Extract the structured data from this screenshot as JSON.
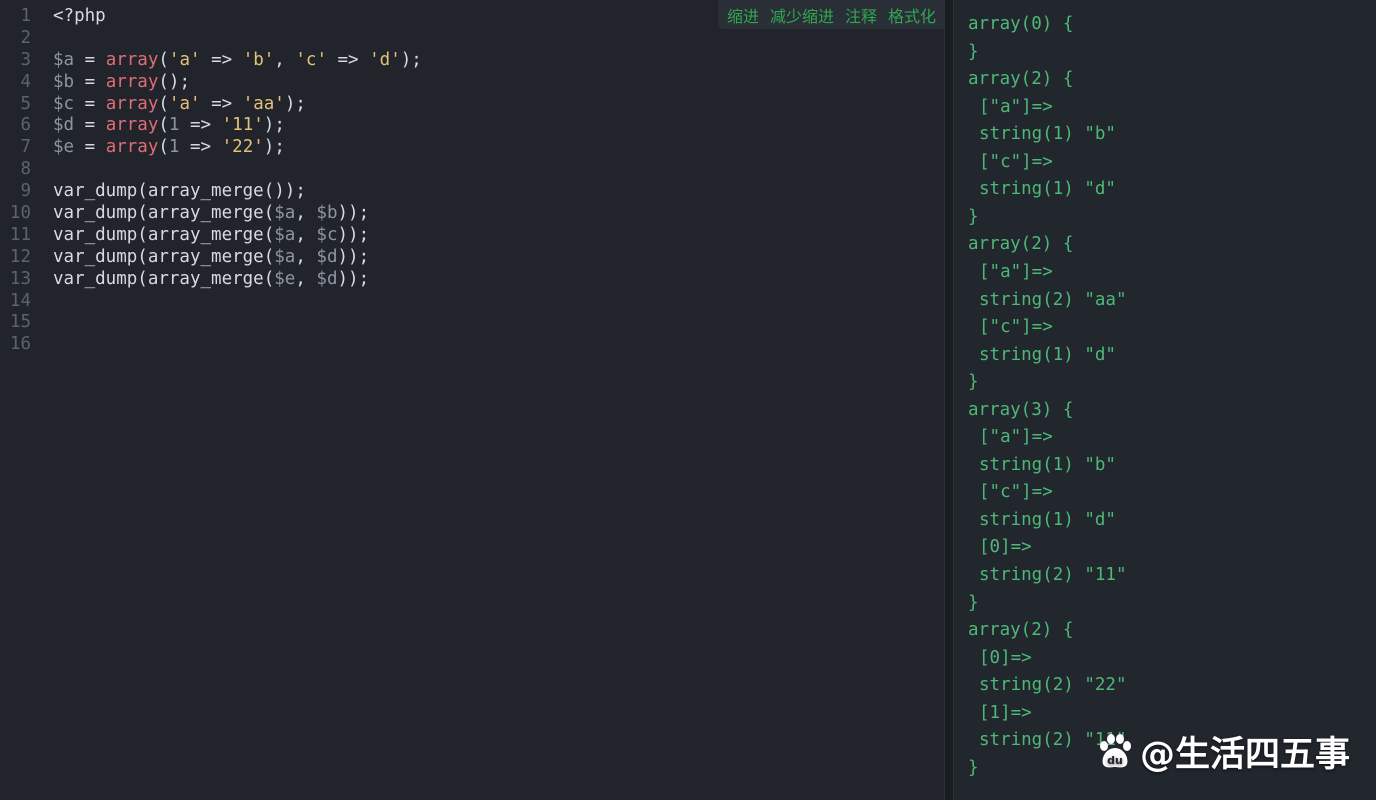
{
  "toolbar": {
    "indent_label": "缩进",
    "outdent_label": "减少缩进",
    "comment_label": "注释",
    "format_label": "格式化"
  },
  "editor": {
    "lines": [
      {
        "n": "1",
        "tokens": [
          {
            "t": "<?php",
            "c": "plain"
          }
        ]
      },
      {
        "n": "2",
        "tokens": []
      },
      {
        "n": "3",
        "tokens": [
          {
            "t": "$a",
            "c": "var"
          },
          {
            "t": " = ",
            "c": "plain"
          },
          {
            "t": "array",
            "c": "fn"
          },
          {
            "t": "(",
            "c": "plain"
          },
          {
            "t": "'a'",
            "c": "str"
          },
          {
            "t": " => ",
            "c": "plain"
          },
          {
            "t": "'b'",
            "c": "str"
          },
          {
            "t": ", ",
            "c": "plain"
          },
          {
            "t": "'c'",
            "c": "str"
          },
          {
            "t": " => ",
            "c": "plain"
          },
          {
            "t": "'d'",
            "c": "str"
          },
          {
            "t": ");",
            "c": "plain"
          }
        ]
      },
      {
        "n": "4",
        "tokens": [
          {
            "t": "$b",
            "c": "var"
          },
          {
            "t": " = ",
            "c": "plain"
          },
          {
            "t": "array",
            "c": "fn"
          },
          {
            "t": "();",
            "c": "plain"
          }
        ]
      },
      {
        "n": "5",
        "tokens": [
          {
            "t": "$c",
            "c": "var"
          },
          {
            "t": " = ",
            "c": "plain"
          },
          {
            "t": "array",
            "c": "fn"
          },
          {
            "t": "(",
            "c": "plain"
          },
          {
            "t": "'a'",
            "c": "str"
          },
          {
            "t": " => ",
            "c": "plain"
          },
          {
            "t": "'aa'",
            "c": "str"
          },
          {
            "t": ");",
            "c": "plain"
          }
        ]
      },
      {
        "n": "6",
        "tokens": [
          {
            "t": "$d",
            "c": "var"
          },
          {
            "t": " = ",
            "c": "plain"
          },
          {
            "t": "array",
            "c": "fn"
          },
          {
            "t": "(",
            "c": "plain"
          },
          {
            "t": "1",
            "c": "num"
          },
          {
            "t": " => ",
            "c": "plain"
          },
          {
            "t": "'11'",
            "c": "str"
          },
          {
            "t": ");",
            "c": "plain"
          }
        ]
      },
      {
        "n": "7",
        "tokens": [
          {
            "t": "$e",
            "c": "var"
          },
          {
            "t": " = ",
            "c": "plain"
          },
          {
            "t": "array",
            "c": "fn"
          },
          {
            "t": "(",
            "c": "plain"
          },
          {
            "t": "1",
            "c": "num"
          },
          {
            "t": " => ",
            "c": "plain"
          },
          {
            "t": "'22'",
            "c": "str"
          },
          {
            "t": ");",
            "c": "plain"
          }
        ]
      },
      {
        "n": "8",
        "tokens": []
      },
      {
        "n": "9",
        "tokens": [
          {
            "t": "var_dump(array_merge());",
            "c": "plain"
          }
        ]
      },
      {
        "n": "10",
        "tokens": [
          {
            "t": "var_dump(array_merge(",
            "c": "plain"
          },
          {
            "t": "$a",
            "c": "var"
          },
          {
            "t": ", ",
            "c": "plain"
          },
          {
            "t": "$b",
            "c": "var"
          },
          {
            "t": "));",
            "c": "plain"
          }
        ]
      },
      {
        "n": "11",
        "tokens": [
          {
            "t": "var_dump(array_merge(",
            "c": "plain"
          },
          {
            "t": "$a",
            "c": "var"
          },
          {
            "t": ", ",
            "c": "plain"
          },
          {
            "t": "$c",
            "c": "var"
          },
          {
            "t": "));",
            "c": "plain"
          }
        ]
      },
      {
        "n": "12",
        "tokens": [
          {
            "t": "var_dump(array_merge(",
            "c": "plain"
          },
          {
            "t": "$a",
            "c": "var"
          },
          {
            "t": ", ",
            "c": "plain"
          },
          {
            "t": "$d",
            "c": "var"
          },
          {
            "t": "));",
            "c": "plain"
          }
        ]
      },
      {
        "n": "13",
        "tokens": [
          {
            "t": "var_dump(array_merge(",
            "c": "plain"
          },
          {
            "t": "$e",
            "c": "var"
          },
          {
            "t": ", ",
            "c": "plain"
          },
          {
            "t": "$d",
            "c": "var"
          },
          {
            "t": "));",
            "c": "plain"
          }
        ]
      },
      {
        "n": "14",
        "tokens": []
      },
      {
        "n": "15",
        "tokens": []
      },
      {
        "n": "16",
        "tokens": []
      }
    ]
  },
  "output": {
    "lines": [
      {
        "text": "array(0) {",
        "indent": false
      },
      {
        "text": "}",
        "indent": false
      },
      {
        "text": "array(2) {",
        "indent": false
      },
      {
        "text": "[\"a\"]=>",
        "indent": true
      },
      {
        "text": "string(1) \"b\"",
        "indent": true
      },
      {
        "text": "[\"c\"]=>",
        "indent": true
      },
      {
        "text": "string(1) \"d\"",
        "indent": true
      },
      {
        "text": "}",
        "indent": false
      },
      {
        "text": "array(2) {",
        "indent": false
      },
      {
        "text": "[\"a\"]=>",
        "indent": true
      },
      {
        "text": "string(2) \"aa\"",
        "indent": true
      },
      {
        "text": "[\"c\"]=>",
        "indent": true
      },
      {
        "text": "string(1) \"d\"",
        "indent": true
      },
      {
        "text": "}",
        "indent": false
      },
      {
        "text": "array(3) {",
        "indent": false
      },
      {
        "text": "[\"a\"]=>",
        "indent": true
      },
      {
        "text": "string(1) \"b\"",
        "indent": true
      },
      {
        "text": "[\"c\"]=>",
        "indent": true
      },
      {
        "text": "string(1) \"d\"",
        "indent": true
      },
      {
        "text": "[0]=>",
        "indent": true
      },
      {
        "text": "string(2) \"11\"",
        "indent": true
      },
      {
        "text": "}",
        "indent": false
      },
      {
        "text": "array(2) {",
        "indent": false
      },
      {
        "text": "[0]=>",
        "indent": true
      },
      {
        "text": "string(2) \"22\"",
        "indent": true
      },
      {
        "text": "[1]=>",
        "indent": true
      },
      {
        "text": "string(2) \"11\"",
        "indent": true
      },
      {
        "text": "}",
        "indent": false
      }
    ]
  },
  "watermark": {
    "logo_icon": "baidu-paw-icon",
    "logo_text": "du",
    "text": "@生活四五事"
  }
}
